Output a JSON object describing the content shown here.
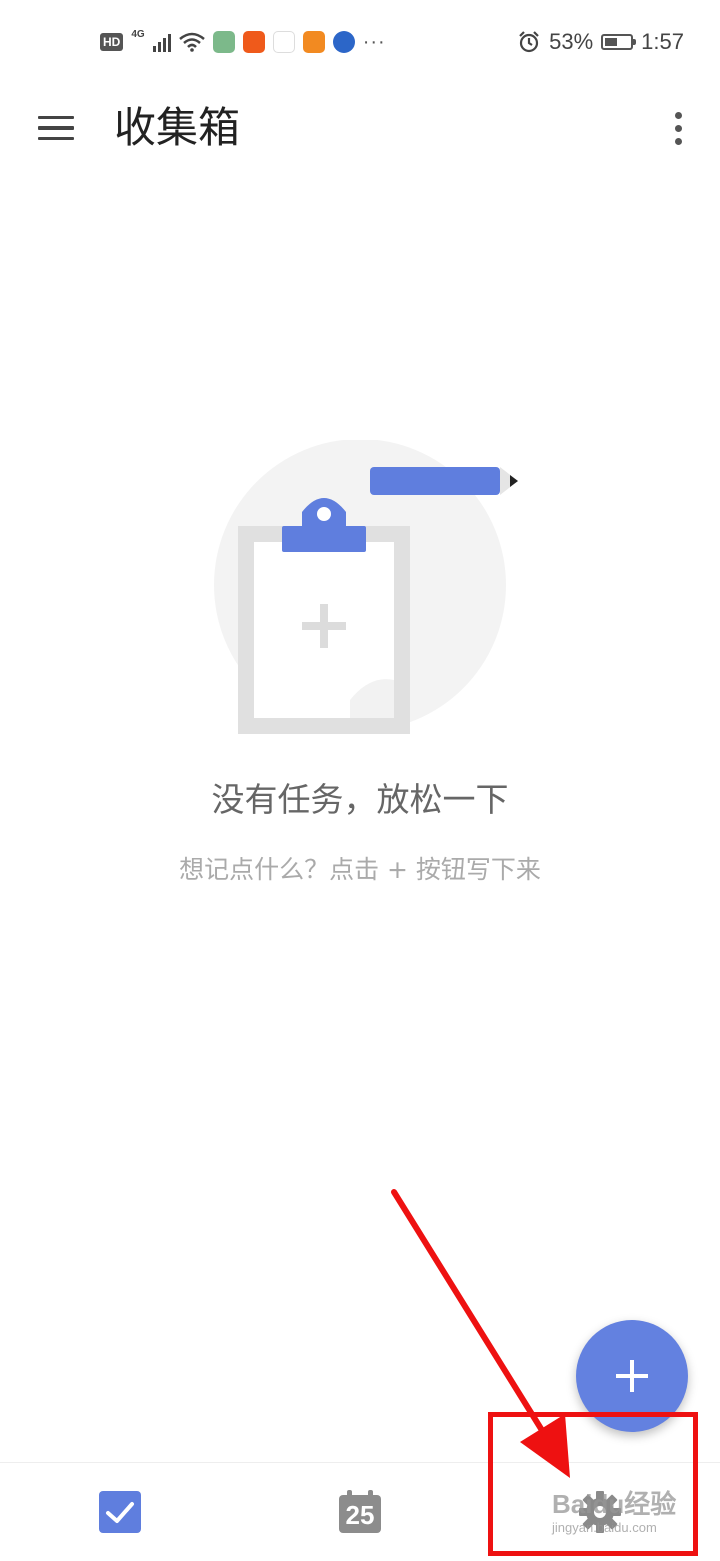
{
  "status_bar": {
    "hd": "HD",
    "network": "4G",
    "more": "···",
    "battery_percent": "53%",
    "battery_level": 0.53,
    "time": "1:57"
  },
  "app_bar": {
    "title": "收集箱"
  },
  "empty_state": {
    "title": "没有任务，放松一下",
    "subtitle": "想记点什么？点击 + 按钮写下来"
  },
  "bottom_nav": {
    "calendar_day": "25",
    "selected": "tasks"
  },
  "colors": {
    "accent": "#6381e0",
    "annotation": "#ee1111"
  },
  "watermark": {
    "text": "Baidu经验",
    "url": "jingyan.baidu.com"
  }
}
